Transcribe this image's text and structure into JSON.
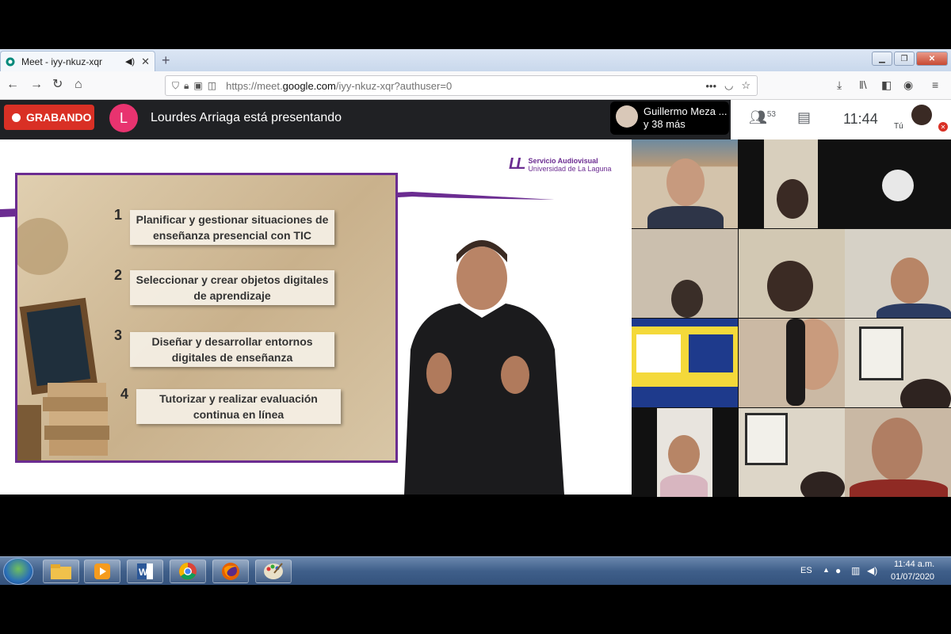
{
  "browser": {
    "tab_title": "Meet - iyy-nkuz-xqr",
    "url_prefix": "https://meet.",
    "url_domain": "google.com",
    "url_suffix": "/iyy-nkuz-xqr?authuser=0",
    "new_tab_symbol": "+"
  },
  "meet": {
    "recording_label": "GRABANDO",
    "presenter_initial": "L",
    "presenting_text": "Lourdes Arriaga está presentando",
    "participant_name": "Guillermo Meza ...",
    "participant_more": "y 38 más",
    "participant_count": "53",
    "clock": "11:44",
    "self_label": "Tú"
  },
  "slide": {
    "brand_line1": "Servicio Audiovisual",
    "brand_line2": "Universidad de La Laguna",
    "items": [
      {
        "number": "1",
        "text": "Planificar y gestionar situaciones de enseñanza presencial con TIC"
      },
      {
        "number": "2",
        "text": "Seleccionar y crear objetos digitales de aprendizaje"
      },
      {
        "number": "3",
        "text": "Diseñar y desarrollar entornos digitales de enseñanza"
      },
      {
        "number": "4",
        "text": "Tutorizar y realizar evaluación continua en línea"
      }
    ]
  },
  "taskbar": {
    "language": "ES",
    "time": "11:44 a.m.",
    "date": "01/07/2020",
    "apps": [
      "file-explorer-icon",
      "media-player-icon",
      "word-icon",
      "chrome-icon",
      "firefox-icon",
      "paint-icon"
    ]
  }
}
